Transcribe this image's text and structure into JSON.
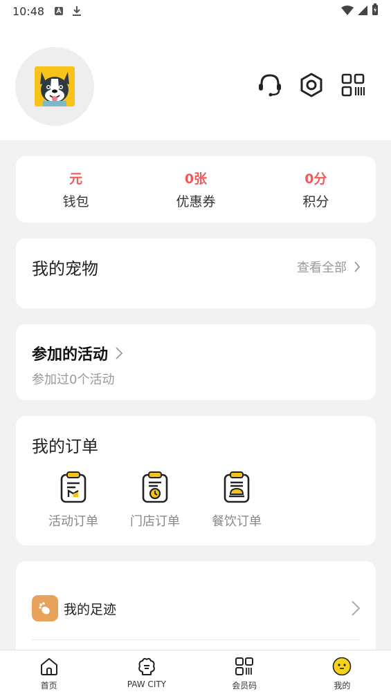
{
  "status_bar": {
    "time": "10:48"
  },
  "stats": [
    {
      "value": "元",
      "label": "钱包"
    },
    {
      "value": "0张",
      "label": "优惠券"
    },
    {
      "value": "0分",
      "label": "积分"
    }
  ],
  "pets": {
    "title": "我的宠物",
    "see_all": "查看全部"
  },
  "activities": {
    "title": "参加的活动",
    "subtitle": "参加过0个活动"
  },
  "orders": {
    "title": "我的订单",
    "items": [
      {
        "label": "活动订单",
        "icon": "activity-order-icon"
      },
      {
        "label": "门店订单",
        "icon": "store-order-icon"
      },
      {
        "label": "餐饮订单",
        "icon": "food-order-icon"
      }
    ]
  },
  "footprint": {
    "label": "我的足迹"
  },
  "nav": [
    {
      "label": "首页",
      "icon": "home-icon"
    },
    {
      "label": "PAW CITY",
      "icon": "paw-city-icon"
    },
    {
      "label": "会员码",
      "icon": "member-code-icon"
    },
    {
      "label": "我的",
      "icon": "profile-face-icon"
    }
  ],
  "colors": {
    "accent_red": "#f25a5a",
    "footprint_orange": "#e9a25b",
    "face_yellow": "#f7d21a"
  }
}
